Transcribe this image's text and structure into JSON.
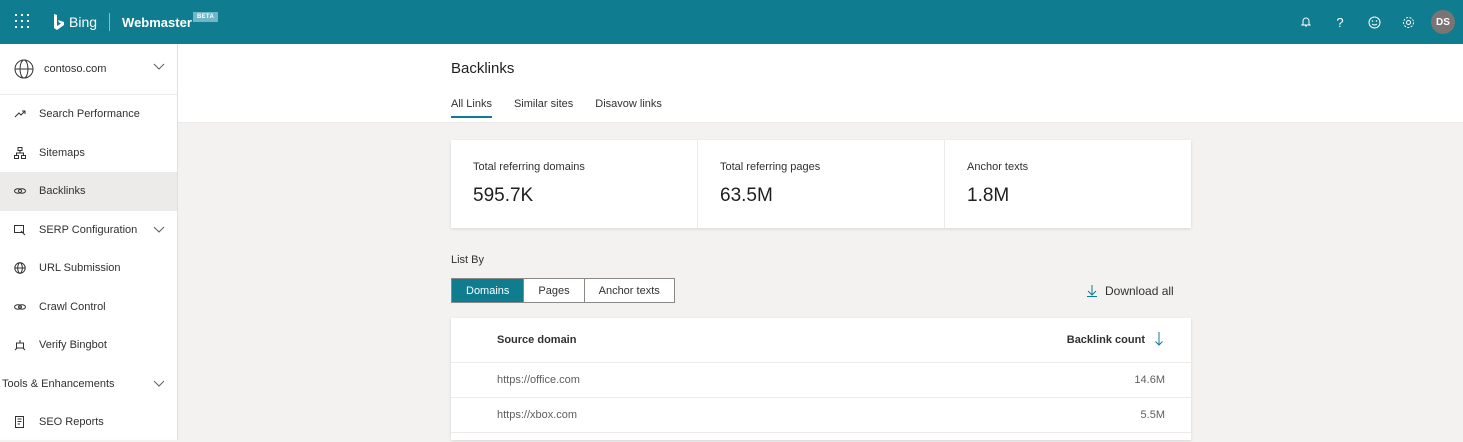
{
  "topbar": {
    "brand": "Bing",
    "product": "Webmaster",
    "badge": "BETA",
    "icons": [
      "bell-icon",
      "help-icon",
      "smiley-icon",
      "settings-icon"
    ],
    "avatar_initials": "DS",
    "color": "#0f7c8f"
  },
  "sidebar": {
    "site": "contoso.com",
    "items": [
      {
        "label": "Search Performance",
        "icon": "trend-icon"
      },
      {
        "label": "Sitemaps",
        "icon": "sitemap-icon"
      },
      {
        "label": "Backlinks",
        "icon": "link-icon",
        "active": true
      },
      {
        "label": "SERP Configuration",
        "icon": "serp-icon",
        "expandable": true
      },
      {
        "label": "URL Submission",
        "icon": "globe-icon"
      },
      {
        "label": "Crawl Control",
        "icon": "crawl-icon"
      },
      {
        "label": "Verify Bingbot",
        "icon": "bot-icon"
      },
      {
        "label": "Tools & Enhancements",
        "expandable": true
      },
      {
        "label": "SEO Reports",
        "icon": "report-icon"
      }
    ]
  },
  "page": {
    "title": "Backlinks",
    "tabs": [
      "All Links",
      "Similar sites",
      "Disavow links"
    ]
  },
  "stats": [
    {
      "label": "Total referring domains",
      "value": "595.7K"
    },
    {
      "label": "Total referring pages",
      "value": "63.5M"
    },
    {
      "label": "Anchor texts",
      "value": "1.8M"
    }
  ],
  "list_by": {
    "label": "List By",
    "options": [
      "Domains",
      "Pages",
      "Anchor texts"
    ],
    "selected": "Domains"
  },
  "download_label": "Download all",
  "table": {
    "columns": [
      "Source domain",
      "Backlink count"
    ],
    "rows": [
      [
        "https://office.com",
        "14.6M"
      ],
      [
        "https://xbox.com",
        "5.5M"
      ]
    ]
  }
}
